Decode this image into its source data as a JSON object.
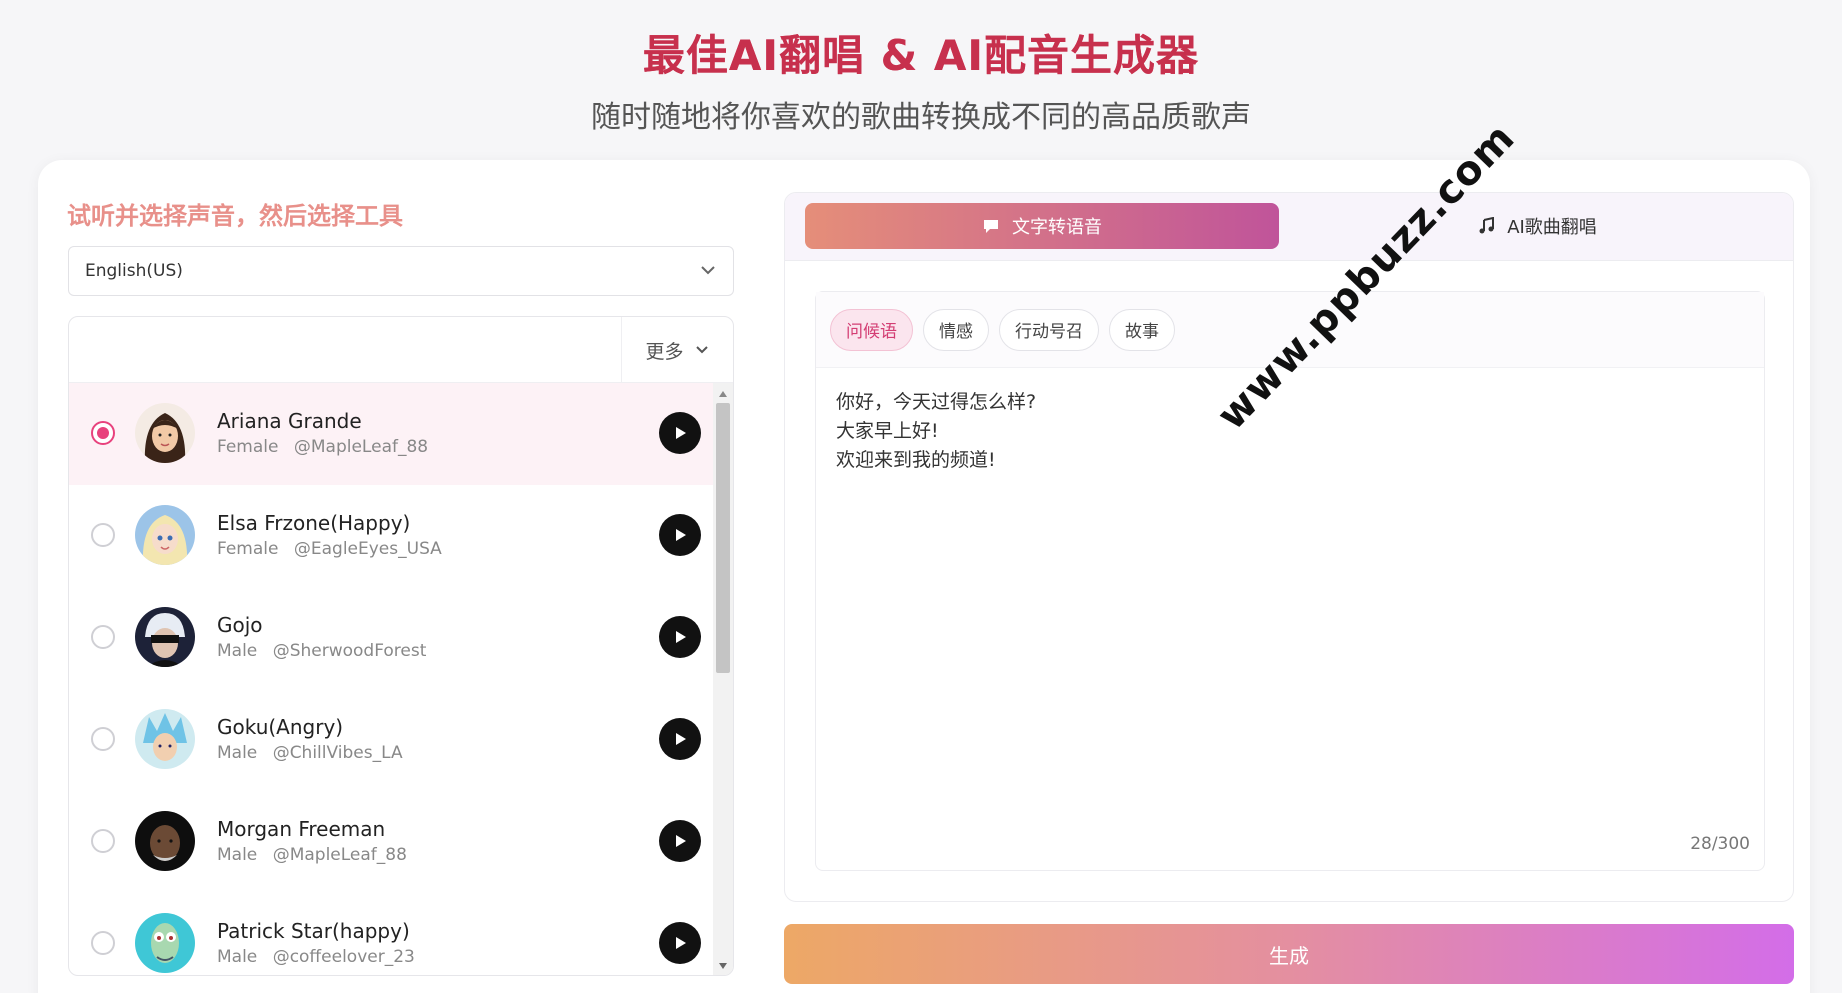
{
  "header": {
    "title": "最佳AI翻唱 & AI配音生成器",
    "subtitle": "随时随地将你喜欢的歌曲转换成不同的高品质歌声"
  },
  "left": {
    "heading": "试听并选择声音，然后选择工具",
    "language": "English(US)",
    "more_label": "更多",
    "voices": [
      {
        "name": "Ariana Grande",
        "gender": "Female",
        "handle": "@MapleLeaf_88",
        "selected": true
      },
      {
        "name": "Elsa Frzone(Happy)",
        "gender": "Female",
        "handle": "@EagleEyes_USA",
        "selected": false
      },
      {
        "name": "Gojo",
        "gender": "Male",
        "handle": "@SherwoodForest",
        "selected": false
      },
      {
        "name": "Goku(Angry)",
        "gender": "Male",
        "handle": "@ChillVibes_LA",
        "selected": false
      },
      {
        "name": "Morgan Freeman",
        "gender": "Male",
        "handle": "@MapleLeaf_88",
        "selected": false
      },
      {
        "name": "Patrick Star(happy)",
        "gender": "Male",
        "handle": "@coffeelover_23",
        "selected": false
      }
    ]
  },
  "right": {
    "tabs": [
      {
        "label": "文字转语音",
        "icon": "chat-bubble-icon",
        "active": true
      },
      {
        "label": "AI歌曲翻唱",
        "icon": "music-note-icon",
        "active": false
      }
    ],
    "chips": [
      {
        "label": "问候语",
        "active": true
      },
      {
        "label": "情感",
        "active": false
      },
      {
        "label": "行动号召",
        "active": false
      },
      {
        "label": "故事",
        "active": false
      }
    ],
    "text_lines": [
      "你好，今天过得怎么样?",
      "大家早上好!",
      "欢迎来到我的频道!"
    ],
    "counter": "28/300",
    "generate_label": "生成"
  },
  "watermark": "www.ppbuzz.com",
  "colors": {
    "title": "#c7304d",
    "heading": "#e8908a",
    "accent_pink": "#e8427d",
    "tab_gradient_start": "#e58e79",
    "tab_gradient_end": "#c0549a",
    "button_gradient_start": "#eda866",
    "button_gradient_end": "#d36de8"
  }
}
